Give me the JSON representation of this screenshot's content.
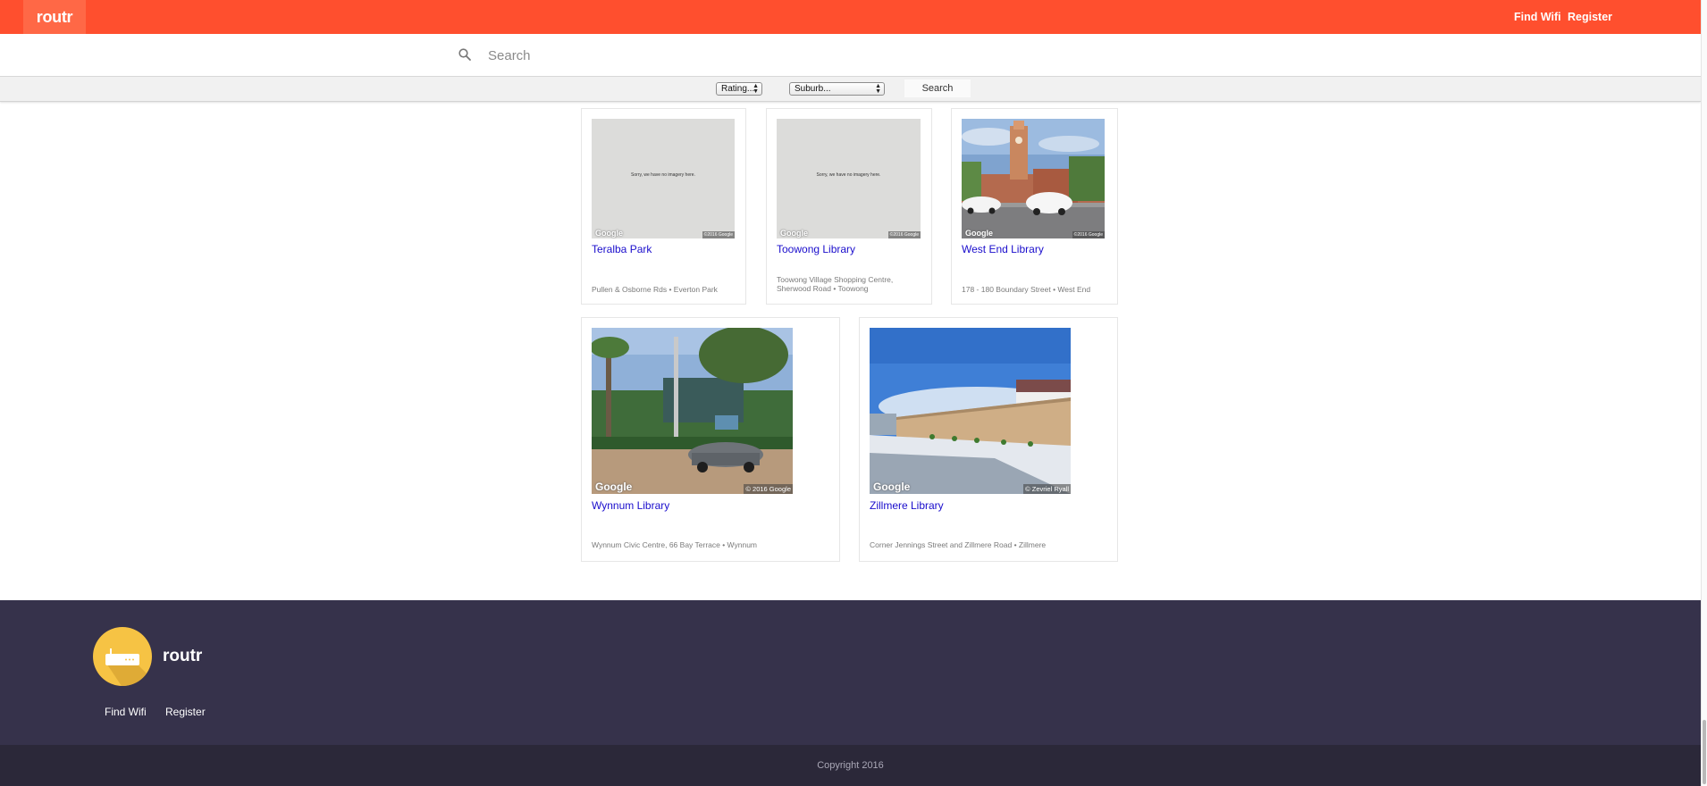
{
  "header": {
    "brand": "routr",
    "nav": {
      "find_wifi": "Find Wifi",
      "register": "Register"
    },
    "accent_color": "#ff4f2e"
  },
  "search": {
    "placeholder": "Search",
    "icon": "search-icon"
  },
  "filters": {
    "rating": "Rating...",
    "suburb": "Suburb...",
    "search_button": "Search"
  },
  "results": [
    {
      "title": "Teralba Park",
      "address": "Pullen & Osborne Rds • Everton Park",
      "image": "no-imagery",
      "no_imagery_text": "Sorry, we have no imagery here.",
      "logo": "Google",
      "copyright": "©2016 Google"
    },
    {
      "title": "Toowong Library",
      "address": "Toowong Village Shopping Centre, Sherwood Road • Toowong",
      "image": "no-imagery",
      "no_imagery_text": "Sorry, we have no imagery here.",
      "logo": "Google",
      "copyright": "©2016 Google"
    },
    {
      "title": "West End Library",
      "address": "178 - 180 Boundary Street • West End",
      "image": "street-view",
      "logo": "Google",
      "copyright": "©2016 Google"
    },
    {
      "title": "Wynnum Library",
      "address": "Wynnum Civic Centre, 66 Bay Terrace • Wynnum",
      "image": "street-view",
      "logo": "Google",
      "copyright": "© 2016 Google"
    },
    {
      "title": "Zillmere Library",
      "address": "Corner Jennings Street and Zillmere Road • Zillmere",
      "image": "street-view",
      "logo": "Google",
      "copyright": "© Zevriel Ryall"
    }
  ],
  "footer": {
    "name": "routr",
    "logo_icon": "router-icon",
    "links": {
      "find_wifi": "Find Wifi",
      "register": "Register"
    },
    "copyright": "Copyright 2016",
    "background": "#36324b"
  }
}
